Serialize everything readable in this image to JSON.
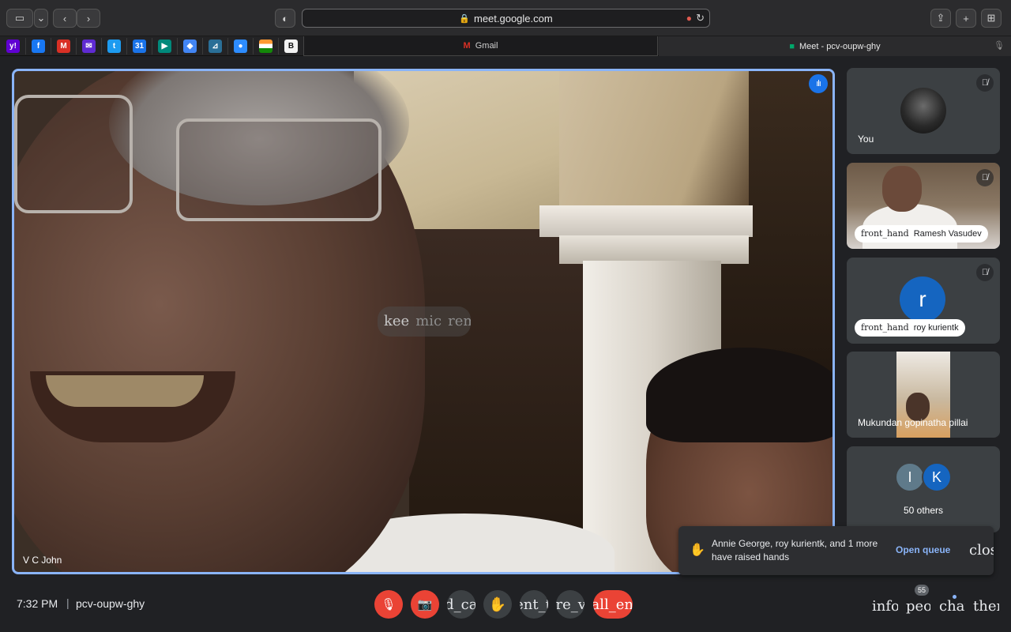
{
  "browser": {
    "url": "meet.google.com",
    "tabs": [
      {
        "label": "Gmail",
        "icon": "gmail-icon"
      },
      {
        "label": "Meet - pcv-oupw-ghy",
        "icon": "meet-icon"
      }
    ],
    "favorites": [
      {
        "name": "yahoo-icon",
        "glyph": "y!",
        "color": "#6001d2"
      },
      {
        "name": "facebook-icon",
        "glyph": "f",
        "color": "#1877f2"
      },
      {
        "name": "gmail-icon",
        "glyph": "M",
        "color": "#d93025"
      },
      {
        "name": "yahoo-mail-icon",
        "glyph": "✉",
        "color": "#5f2bd2"
      },
      {
        "name": "twitter-icon",
        "glyph": "t",
        "color": "#1d9bf0"
      },
      {
        "name": "calendar-icon",
        "glyph": "31",
        "color": "#1a73e8"
      },
      {
        "name": "meet-icon",
        "glyph": "▶",
        "color": "#00897b"
      },
      {
        "name": "maps-icon",
        "glyph": "◆",
        "color": "#4285f4"
      },
      {
        "name": "chart-icon",
        "glyph": "⊿",
        "color": "#2a6f97"
      },
      {
        "name": "zoom-icon",
        "glyph": "●",
        "color": "#2d8cff"
      },
      {
        "name": "india-flag-icon",
        "glyph": "",
        "color": "#ff9933"
      },
      {
        "name": "b-icon",
        "glyph": "B",
        "color": "#f2f2f2"
      }
    ]
  },
  "main": {
    "speaker_name": "V C John",
    "caption_words": [
      "kee",
      "mic",
      "rem"
    ]
  },
  "participants": [
    {
      "name": "You",
      "muted": true
    },
    {
      "name": "Ramesh Vasudev",
      "muted": true,
      "hand_raised": true,
      "hand_ligature": "front_hand"
    },
    {
      "name": "roy kurientk",
      "initial": "r",
      "muted": true,
      "hand_raised": true,
      "hand_ligature": "front_hand"
    },
    {
      "name": "Mukundan gopinatha pillai"
    }
  ],
  "others": {
    "avatars": [
      {
        "initial": "I",
        "color": "#5f7a8a"
      },
      {
        "initial": "K",
        "color": "#1565c0"
      }
    ],
    "label": "50 others"
  },
  "hands_toast": {
    "text": "Annie George, roy kurientk, and 1 more have raised hands",
    "action": "Open queue",
    "close_ligature": "close"
  },
  "bottom": {
    "time": "7:32 PM",
    "separator": "|",
    "meeting_code": "pcv-oupw-ghy",
    "controls": {
      "mic": "🎙",
      "camera": "📷",
      "captions": "closed_caption",
      "hand": "✋",
      "present": "present_to_all",
      "more": "more_vert",
      "end_call": "call_end"
    },
    "side": {
      "info": "info",
      "people": "people",
      "people_count": "55",
      "chat": "chat",
      "activities": "theme"
    }
  }
}
